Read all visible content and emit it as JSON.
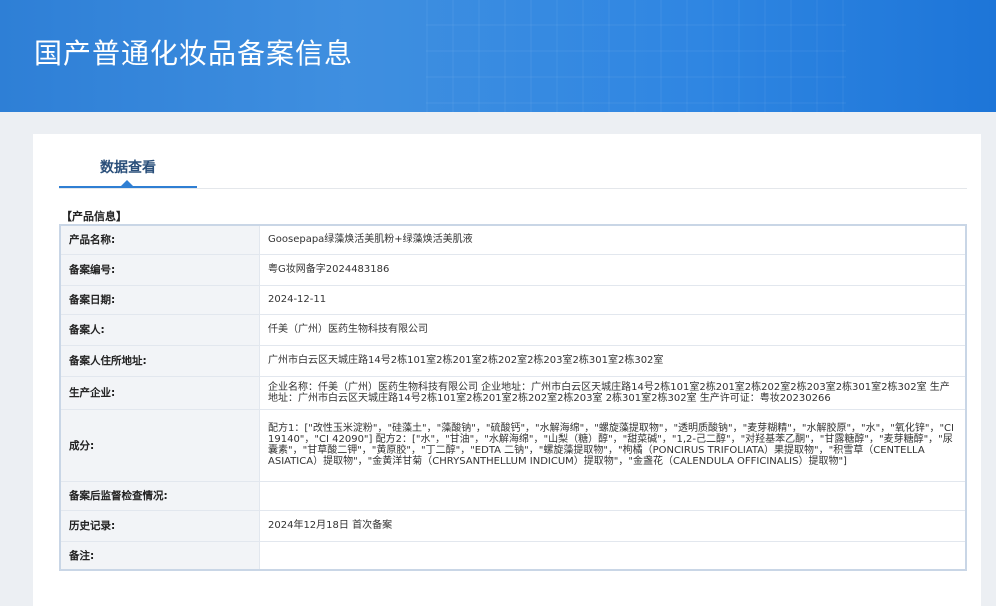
{
  "header": {
    "title": "国产普通化妆品备案信息"
  },
  "tabs": [
    {
      "label": "数据查看"
    }
  ],
  "section": {
    "label": "【产品信息】"
  },
  "rows": [
    {
      "label": "产品名称:",
      "value": "Goosepapa绿藻焕活美肌粉+绿藻焕活美肌液"
    },
    {
      "label": "备案编号:",
      "value": "粤G妆网备字2024483186"
    },
    {
      "label": "备案日期:",
      "value": "2024-12-11"
    },
    {
      "label": "备案人:",
      "value": "仟美（广州）医药生物科技有限公司"
    },
    {
      "label": "备案人住所地址:",
      "value": "广州市白云区天城庄路14号2栋101室2栋201室2栋202室2栋203室2栋301室2栋302室"
    },
    {
      "label": "生产企业:",
      "value": "企业名称：仟美（广州）医药生物科技有限公司 企业地址：广州市白云区天城庄路14号2栋101室2栋201室2栋202室2栋203室2栋301室2栋302室 生产地址：广州市白云区天城庄路14号2栋101室2栋201室2栋202室2栋203室 2栋301室2栋302室 生产许可证：粤妆20230266"
    },
    {
      "label": "成分:",
      "value": "配方1：[\"改性玉米淀粉\"，\"硅藻土\"，\"藻酸钠\"，\"硫酸钙\"，\"水解海绵\"，\"螺旋藻提取物\"，\"透明质酸钠\"，\"麦芽糊精\"，\"水解胶原\"，\"水\"，\"氧化锌\"，\"CI 19140\"，\"CI 42090\"] 配方2：[\"水\"，\"甘油\"，\"水解海绵\"，\"山梨（糖）醇\"，\"甜菜碱\"，\"1,2-己二醇\"，\"对羟基苯乙酮\"，\"甘露糖醇\"，\"麦芽糖醇\"，\"尿囊素\"，\"甘草酸二钾\"，\"黄原胶\"，\"丁二醇\"，\"EDTA 二钠\"，\"螺旋藻提取物\"，\"枸橘（PONCIRUS TRIFOLIATA）果提取物\"，\"积雪草（CENTELLA ASIATICA）提取物\"，\"金黄洋甘菊（CHRYSANTHELLUM INDICUM）提取物\"，\"金盏花（CALENDULA OFFICINALIS）提取物\"]"
    },
    {
      "label": "备案后监督检查情况:",
      "value": ""
    },
    {
      "label": "历史记录:",
      "value": "2024年12月18日 首次备案"
    },
    {
      "label": "备注:",
      "value": ""
    }
  ]
}
